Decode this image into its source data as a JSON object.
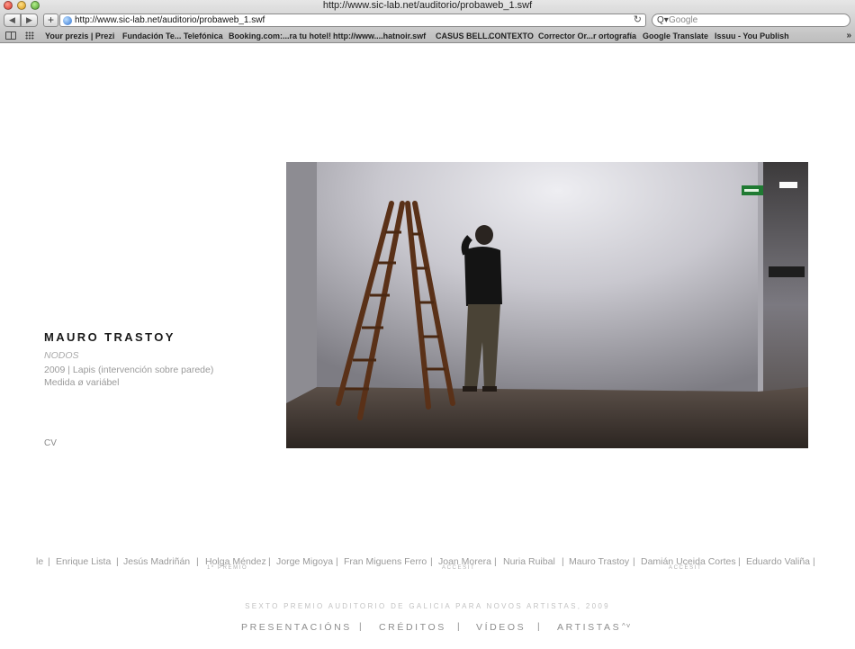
{
  "browser": {
    "window_title": "http://www.sic-lab.net/auditorio/probaweb_1.swf",
    "back_icon": "◀",
    "forward_icon": "▶",
    "add_icon": "+",
    "url": "http://www.sic-lab.net/auditorio/probaweb_1.swf",
    "reload_icon": "↻",
    "search_icon": "Q▾",
    "search_placeholder": "Google",
    "more_icon": "»",
    "bookmarks": [
      "Your prezis | Prezi",
      "Fundación Te... Telefónica",
      "Booking.com:...ra tu hotel!",
      "http://www....hatnoir.swf",
      "CASUS BELL...",
      "CONTEXTO",
      "Corrector Or...r ortografía",
      "Google Translate",
      "Issuu - You Publish"
    ]
  },
  "artwork": {
    "artist": "MAURO TRASTOY",
    "title": "NODOS",
    "description": "2009 | Lapis (intervención sobre parede)",
    "size": "Medida ø variábel",
    "cv_label": "CV"
  },
  "artists": [
    {
      "name": "le",
      "sep": "|"
    },
    {
      "name": "Enrique Lista",
      "sep": "|"
    },
    {
      "name": "Jesús Madriñán",
      "sep": "|"
    },
    {
      "name": "Holga Méndez",
      "sep": "|",
      "prize": "1º PREMIO"
    },
    {
      "name": "Jorge Migoya",
      "sep": "|"
    },
    {
      "name": "Fran Miguens Ferro",
      "sep": "|"
    },
    {
      "name": "Joan Morera",
      "sep": "|",
      "prize": "ACCESIT"
    },
    {
      "name": "Nuria Ruibal",
      "sep": "|"
    },
    {
      "name": "Mauro Trastoy",
      "sep": "|"
    },
    {
      "name": "Damián Uceida Cortes",
      "sep": "|",
      "prize": "ACCESIT"
    },
    {
      "name": "Eduardo Valiña",
      "sep": "|"
    }
  ],
  "footer": {
    "title": "SEXTO PREMIO AUDITORIO DE GALICIA PARA NOVOS ARTISTAS, 2009",
    "nav": [
      {
        "label": "PRESENTACIÓNS",
        "sep": "|"
      },
      {
        "label": "CRÉDITOS",
        "sep": "|"
      },
      {
        "label": "VÍDEOS",
        "sep": "|"
      },
      {
        "label": "ARTISTAS"
      }
    ],
    "arrows": "^˅"
  },
  "colors": {
    "text_dark": "#1a1a1a",
    "text_grey": "#9a9a9a",
    "footer_grey": "#c2c2c2"
  }
}
